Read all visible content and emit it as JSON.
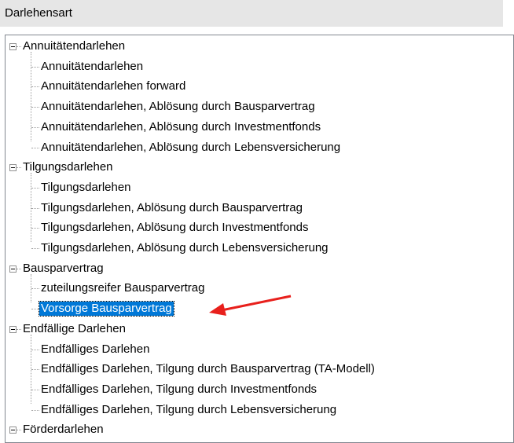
{
  "header": {
    "title": "Darlehensart"
  },
  "tree": [
    {
      "label": "Annuitätendarlehen",
      "expanded": true,
      "children": [
        {
          "label": "Annuitätendarlehen"
        },
        {
          "label": "Annuitätendarlehen forward"
        },
        {
          "label": "Annuitätendarlehen, Ablösung durch Bausparvertrag"
        },
        {
          "label": "Annuitätendarlehen, Ablösung durch Investmentfonds"
        },
        {
          "label": "Annuitätendarlehen, Ablösung durch Lebensversicherung"
        }
      ]
    },
    {
      "label": "Tilgungsdarlehen",
      "expanded": true,
      "children": [
        {
          "label": "Tilgungsdarlehen"
        },
        {
          "label": "Tilgungsdarlehen, Ablösung durch Bausparvertrag"
        },
        {
          "label": "Tilgungsdarlehen, Ablösung durch Investmentfonds"
        },
        {
          "label": "Tilgungsdarlehen, Ablösung durch Lebensversicherung"
        }
      ]
    },
    {
      "label": "Bausparvertrag",
      "expanded": true,
      "children": [
        {
          "label": "zuteilungsreifer Bausparvertrag"
        },
        {
          "label": "Vorsorge Bausparvertrag",
          "selected": true
        }
      ]
    },
    {
      "label": "Endfällige Darlehen",
      "expanded": true,
      "children": [
        {
          "label": "Endfälliges Darlehen"
        },
        {
          "label": "Endfälliges Darlehen, Tilgung durch Bausparvertrag (TA-Modell)"
        },
        {
          "label": "Endfälliges Darlehen, Tilgung durch Investmentfonds"
        },
        {
          "label": "Endfälliges Darlehen, Tilgung durch Lebensversicherung"
        }
      ]
    },
    {
      "label": "Förderdarlehen",
      "expanded": true,
      "children": []
    }
  ],
  "colors": {
    "selection": "#0078d7",
    "annotation_arrow": "#e8201c"
  },
  "annotation": {
    "icon": "red-arrow-icon",
    "points_to": "Vorsorge Bausparvertrag"
  }
}
